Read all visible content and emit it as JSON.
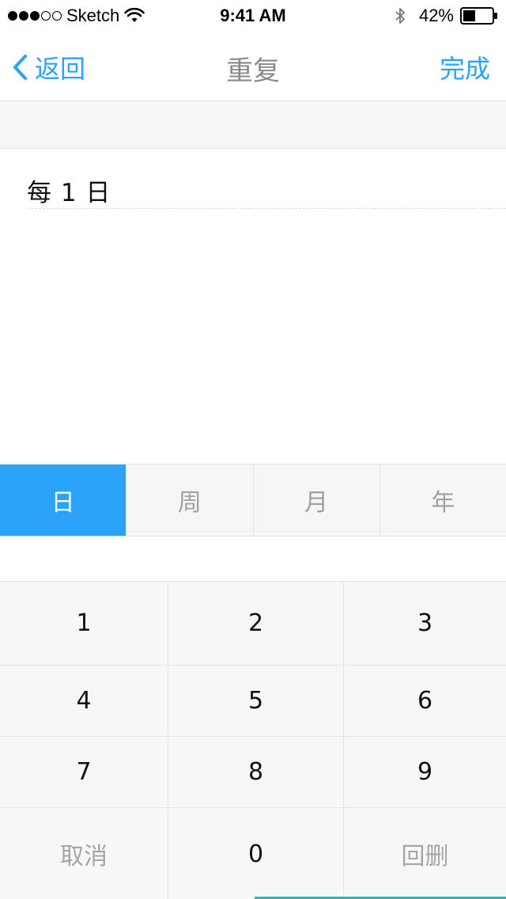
{
  "status_bar": {
    "carrier": "Sketch",
    "time": "9:41 AM",
    "battery_percent": "42%",
    "signal_bars_filled": 3,
    "signal_bars_total": 5,
    "battery_level": 0.42
  },
  "nav": {
    "back_label": "返回",
    "title": "重复",
    "done_label": "完成",
    "accent_color": "#2aa3f8"
  },
  "repeat": {
    "summary": "每 1 日"
  },
  "tabs": [
    {
      "label": "日",
      "active": true
    },
    {
      "label": "周",
      "active": false
    },
    {
      "label": "月",
      "active": false
    },
    {
      "label": "年",
      "active": false
    }
  ],
  "keypad": {
    "keys": [
      [
        "1",
        "2",
        "3"
      ],
      [
        "4",
        "5",
        "6"
      ],
      [
        "7",
        "8",
        "9"
      ],
      [
        "取消",
        "0",
        "回删"
      ]
    ]
  }
}
